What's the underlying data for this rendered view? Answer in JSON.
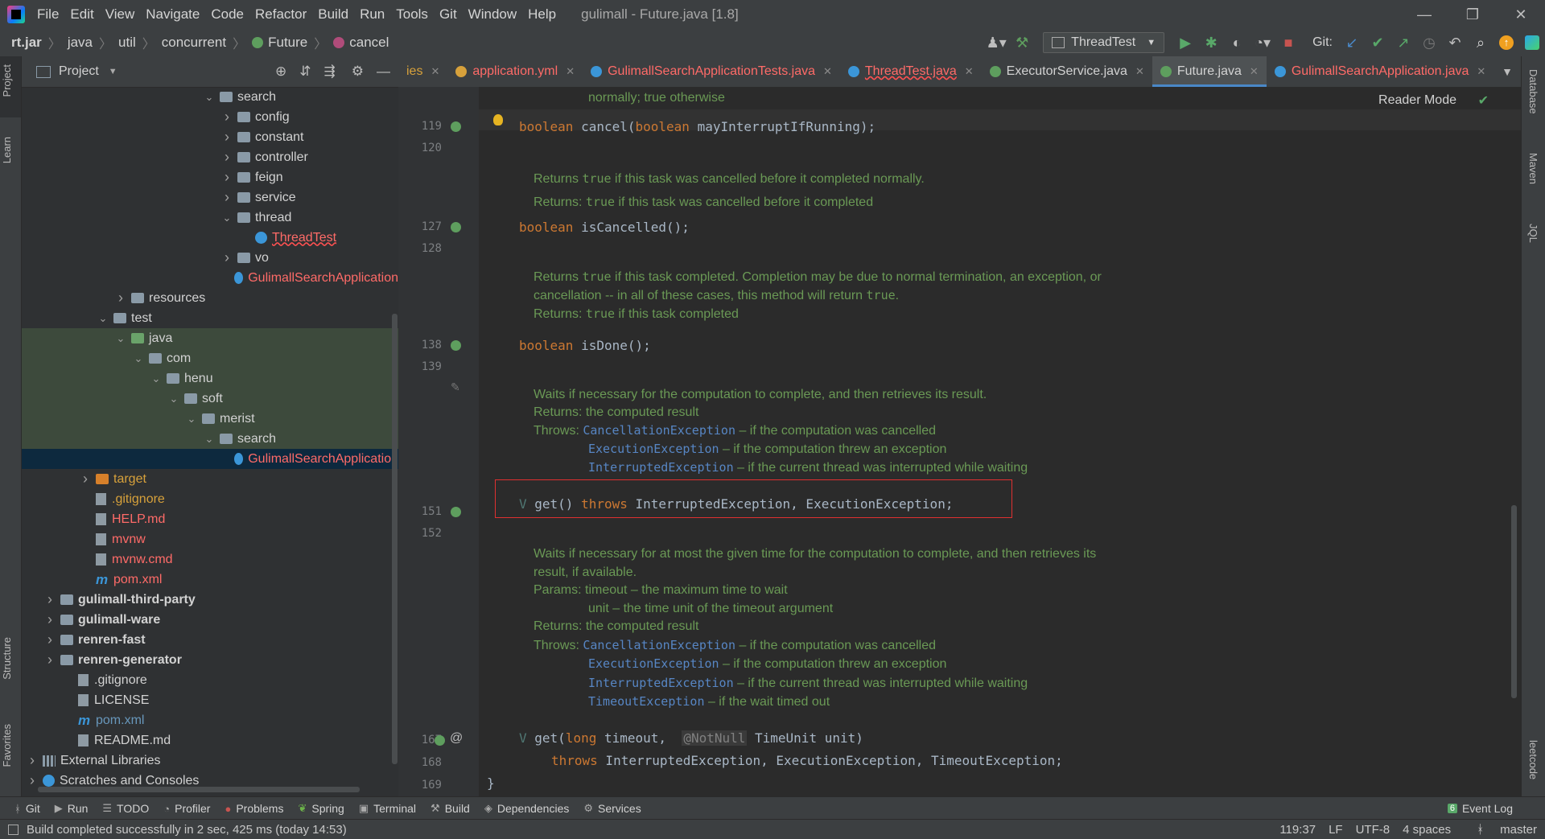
{
  "window": {
    "title": "gulimall - Future.java [1.8]",
    "controls": [
      "—",
      "❐",
      "✕"
    ]
  },
  "menu": [
    "File",
    "Edit",
    "View",
    "Navigate",
    "Code",
    "Refactor",
    "Build",
    "Run",
    "Tools",
    "Git",
    "Window",
    "Help"
  ],
  "breadcrumb": [
    "rt.jar",
    "java",
    "util",
    "concurrent",
    "Future",
    "cancel"
  ],
  "toolbar": {
    "run_config": "ThreadTest",
    "git_label": "Git:"
  },
  "left_strip": {
    "project": "Project",
    "learn": "Learn",
    "structure": "Structure",
    "favorites": "Favorites"
  },
  "project_panel": {
    "title": "Project",
    "tree": [
      {
        "label": "search",
        "indent": 10,
        "arrow": "open",
        "icon": "folder"
      },
      {
        "label": "config",
        "indent": 11,
        "arrow": "closed",
        "icon": "folder"
      },
      {
        "label": "constant",
        "indent": 11,
        "arrow": "closed",
        "icon": "folder"
      },
      {
        "label": "controller",
        "indent": 11,
        "arrow": "closed",
        "icon": "folder"
      },
      {
        "label": "feign",
        "indent": 11,
        "arrow": "closed",
        "icon": "folder"
      },
      {
        "label": "service",
        "indent": 11,
        "arrow": "closed",
        "icon": "folder"
      },
      {
        "label": "thread",
        "indent": 11,
        "arrow": "open",
        "icon": "folder"
      },
      {
        "label": "ThreadTest",
        "indent": 12,
        "arrow": "",
        "icon": "class",
        "style": "red-err"
      },
      {
        "label": "vo",
        "indent": 11,
        "arrow": "closed",
        "icon": "folder"
      },
      {
        "label": "GulimallSearchApplication",
        "indent": 11,
        "arrow": "",
        "icon": "class",
        "style": "red"
      },
      {
        "label": "resources",
        "indent": 5,
        "arrow": "closed",
        "icon": "folder"
      },
      {
        "label": "test",
        "indent": 4,
        "arrow": "open",
        "icon": "folder"
      },
      {
        "label": "java",
        "indent": 5,
        "arrow": "open",
        "icon": "folder-src",
        "row": "hl"
      },
      {
        "label": "com",
        "indent": 6,
        "arrow": "open",
        "icon": "folder",
        "row": "hl"
      },
      {
        "label": "henu",
        "indent": 7,
        "arrow": "open",
        "icon": "folder",
        "row": "hl"
      },
      {
        "label": "soft",
        "indent": 8,
        "arrow": "open",
        "icon": "folder",
        "row": "hl"
      },
      {
        "label": "merist",
        "indent": 9,
        "arrow": "open",
        "icon": "folder",
        "row": "hl"
      },
      {
        "label": "search",
        "indent": 10,
        "arrow": "open",
        "icon": "folder",
        "row": "hl"
      },
      {
        "label": "GulimallSearchApplication",
        "indent": 11,
        "arrow": "",
        "icon": "class",
        "style": "red",
        "row": "sel"
      },
      {
        "label": "target",
        "indent": 3,
        "arrow": "closed",
        "icon": "folder-orange",
        "style": "orange"
      },
      {
        "label": ".gitignore",
        "indent": 3,
        "arrow": "",
        "icon": "file",
        "style": "orange"
      },
      {
        "label": "HELP.md",
        "indent": 3,
        "arrow": "",
        "icon": "file",
        "style": "red"
      },
      {
        "label": "mvnw",
        "indent": 3,
        "arrow": "",
        "icon": "file",
        "style": "red"
      },
      {
        "label": "mvnw.cmd",
        "indent": 3,
        "arrow": "",
        "icon": "file",
        "style": "red"
      },
      {
        "label": "pom.xml",
        "indent": 3,
        "arrow": "",
        "icon": "m",
        "style": "red"
      },
      {
        "label": "gulimall-third-party",
        "indent": 1,
        "arrow": "closed",
        "icon": "folder",
        "style": "bold"
      },
      {
        "label": "gulimall-ware",
        "indent": 1,
        "arrow": "closed",
        "icon": "folder",
        "style": "bold"
      },
      {
        "label": "renren-fast",
        "indent": 1,
        "arrow": "closed",
        "icon": "folder",
        "style": "bold"
      },
      {
        "label": "renren-generator",
        "indent": 1,
        "arrow": "closed",
        "icon": "folder",
        "style": "bold"
      },
      {
        "label": ".gitignore",
        "indent": 2,
        "arrow": "",
        "icon": "file"
      },
      {
        "label": "LICENSE",
        "indent": 2,
        "arrow": "",
        "icon": "file"
      },
      {
        "label": "pom.xml",
        "indent": 2,
        "arrow": "",
        "icon": "m",
        "style": "blue"
      },
      {
        "label": "README.md",
        "indent": 2,
        "arrow": "",
        "icon": "file"
      },
      {
        "label": "External Libraries",
        "indent": 0,
        "arrow": "closed",
        "icon": "lib"
      },
      {
        "label": "Scratches and Consoles",
        "indent": 0,
        "arrow": "closed",
        "icon": "class"
      }
    ]
  },
  "tabs": [
    {
      "label": "ies",
      "color": "#d7a13b",
      "icon": ""
    },
    {
      "label": "application.yml",
      "color": "#ff6b68",
      "icon": "#d7a13b"
    },
    {
      "label": "GulimallSearchApplicationTests.java",
      "color": "#ff6b68",
      "icon": "#3b96d8"
    },
    {
      "label": "ThreadTest.java",
      "color": "#ff6b68",
      "icon": "#3b96d8"
    },
    {
      "label": "ExecutorService.java",
      "color": "#d2d2d2",
      "icon": "#5e9e5e"
    },
    {
      "label": "Future.java",
      "color": "#d2d2d2",
      "icon": "#5e9e5e",
      "active": true
    },
    {
      "label": "GulimallSearchApplication.java",
      "color": "#ff6b68",
      "icon": "#3b96d8"
    }
  ],
  "editor": {
    "reader_mode": "Reader Mode",
    "doc_top": "normally; true otherwise",
    "line_numbers": [
      "119",
      "120",
      "127",
      "128",
      "138",
      "139",
      "151",
      "152",
      "167",
      "168",
      "169"
    ],
    "cancel_sig": {
      "kw": "boolean",
      "name": " cancel(",
      "kw2": "boolean",
      "param": " mayInterruptIfRunning);"
    },
    "doc_cancelled": {
      "l1a": "Returns ",
      "l1b": "true",
      "l1c": " if this task was cancelled before it completed normally.",
      "l2a": "Returns: ",
      "l2b": "true",
      "l2c": " if this task was cancelled before it completed"
    },
    "isCancelled_sig": {
      "kw": "boolean",
      "rest": " isCancelled();"
    },
    "doc_done": {
      "l1a": "Returns ",
      "l1b": "true",
      "l1c": " if this task completed. Completion may be due to normal termination, an exception, or",
      "l2a": "cancellation -- in all of these cases, this method will return ",
      "l2b": "true",
      "l2c": ".",
      "l3a": "Returns: ",
      "l3b": "true",
      "l3c": " if this task completed"
    },
    "isDone_sig": {
      "kw": "boolean",
      "rest": " isDone();"
    },
    "doc_get": {
      "l1": "Waits if necessary for the computation to complete, and then retrieves its result.",
      "l2": "Returns: the computed result",
      "throws": "Throws: ",
      "e1": "CancellationException",
      "e1d": " – if the computation was cancelled",
      "e2": "ExecutionException",
      "e2d": " – if the computation threw an exception",
      "e3": "InterruptedException",
      "e3d": " – if the current thread was interrupted while waiting"
    },
    "get_sig": {
      "v": "V",
      "name": " get() ",
      "kw": "throws",
      "rest": " InterruptedException, ExecutionException;"
    },
    "doc_get2": {
      "l1": "Waits if necessary for at most the given time for the computation to complete, and then retrieves its",
      "l1b": "result, if available.",
      "p1": "Params: timeout – the maximum time to wait",
      "p2": "unit – the time unit of the timeout argument",
      "r": "Returns: the computed result",
      "throws": "Throws: ",
      "e1": "CancellationException",
      "e1d": " – if the computation was cancelled",
      "e2": "ExecutionException",
      "e2d": " – if the computation threw an exception",
      "e3": "InterruptedException",
      "e3d": " – if the current thread was interrupted while waiting",
      "e4": "TimeoutException",
      "e4d": " – if the wait timed out"
    },
    "get2_sig": {
      "v": "V",
      "name": " get(",
      "kw": "long",
      "p": " timeout,  ",
      "ann": "@NotNull",
      "p2": " TimeUnit unit)"
    },
    "get2_throws": {
      "kw": "throws",
      "rest": " InterruptedException, ExecutionException, TimeoutException;"
    },
    "close_brace": "}"
  },
  "right_strip": {
    "database": "Database",
    "maven": "Maven",
    "jql": "JQL",
    "leetcode": "leetcode"
  },
  "tool_tabs": [
    {
      "icon": "ᚼ",
      "label": "Git"
    },
    {
      "icon": "▶",
      "label": "Run"
    },
    {
      "icon": "☰",
      "label": "TODO"
    },
    {
      "icon": "◔",
      "label": "Profiler"
    },
    {
      "icon": "●",
      "label": "Problems"
    },
    {
      "icon": "❦",
      "label": "Spring"
    },
    {
      "icon": "▣",
      "label": "Terminal"
    },
    {
      "icon": "⚒",
      "label": "Build"
    },
    {
      "icon": "◈",
      "label": "Dependencies"
    },
    {
      "icon": "⚙",
      "label": "Services"
    }
  ],
  "event_log": {
    "count": "6",
    "label": "Event Log"
  },
  "status": {
    "message": "Build completed successfully in 2 sec, 425 ms (today 14:53)",
    "position": "119:37",
    "line_sep": "LF",
    "encoding": "UTF-8",
    "indent": "4 spaces",
    "branch": "master"
  },
  "colors": {
    "accent": "#4a88c7",
    "error_box": "#e03030",
    "doc": "#6a9955",
    "keyword": "#cc7832"
  }
}
